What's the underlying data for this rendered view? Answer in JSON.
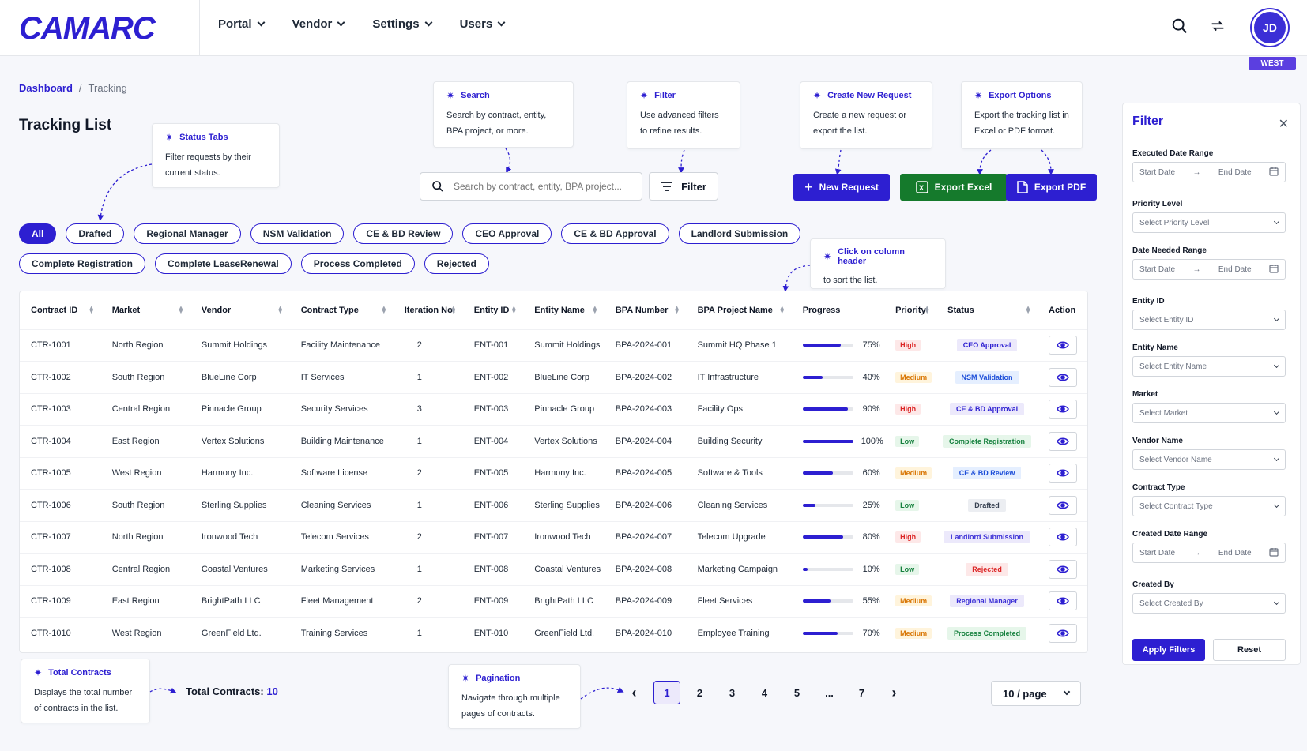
{
  "brand": {
    "logo": "CAMARC"
  },
  "nav": [
    "Portal",
    "Vendor",
    "Settings",
    "Users"
  ],
  "user": {
    "initials": "JD",
    "region": "WEST"
  },
  "breadcrumb": {
    "home": "Dashboard",
    "sep": "/",
    "current": "Tracking"
  },
  "page_title": "Tracking List",
  "callouts": {
    "status_tabs": {
      "title": "Status Tabs",
      "desc": "Filter requests by their current status."
    },
    "search": {
      "title": "Search",
      "desc": "Search by contract, entity, BPA project, or more."
    },
    "filter": {
      "title": "Filter",
      "desc": "Use advanced filters to refine results."
    },
    "create": {
      "title": "Create New Request",
      "desc": "Create a new request or export the list."
    },
    "export": {
      "title": "Export Options",
      "desc": "Export the tracking list in Excel or PDF format."
    },
    "sort": {
      "title": "Click on column header",
      "desc": "to sort the list."
    },
    "total": {
      "title": "Total Contracts",
      "desc": "Displays the total number of contracts in the list."
    },
    "pagination": {
      "title": "Pagination",
      "desc": "Navigate through multiple pages of contracts."
    }
  },
  "search": {
    "placeholder": "Search by contract, entity, BPA project..."
  },
  "toolbar": {
    "filter_label": "Filter",
    "new_label": "New Request",
    "excel_label": "Export Excel",
    "pdf_label": "Export PDF"
  },
  "tabs_row1": [
    "All",
    "Drafted",
    "Regional Manager",
    "NSM Validation",
    "CE & BD Review",
    "CEO Approval",
    "CE & BD Approval",
    "Landlord Submission"
  ],
  "tabs_row2": [
    "Complete Registration",
    "Complete LeaseRenewal",
    "Process Completed",
    "Rejected"
  ],
  "active_tab": "All",
  "table": {
    "columns": [
      "Contract ID",
      "Market",
      "Vendor",
      "Contract Type",
      "Iteration No.",
      "Entity ID",
      "Entity Name",
      "BPA Number",
      "BPA Project Name",
      "Progress",
      "Priority",
      "Status",
      "Action"
    ],
    "rows": [
      {
        "id": "CTR-1001",
        "market": "North Region",
        "vendor": "Summit Holdings",
        "type": "Facility Maintenance",
        "iter": "2",
        "entity_id": "ENT-001",
        "entity_name": "Summit Holdings",
        "bpa": "BPA-2024-001",
        "project": "Summit HQ Phase 1",
        "progress": 75,
        "progress_label": "75%",
        "priority": "High",
        "status": "CEO Approval"
      },
      {
        "id": "CTR-1002",
        "market": "South Region",
        "vendor": "BlueLine Corp",
        "type": "IT Services",
        "iter": "1",
        "entity_id": "ENT-002",
        "entity_name": "BlueLine Corp",
        "bpa": "BPA-2024-002",
        "project": "IT Infrastructure",
        "progress": 40,
        "progress_label": "40%",
        "priority": "Medium",
        "status": "NSM Validation"
      },
      {
        "id": "CTR-1003",
        "market": "Central Region",
        "vendor": "Pinnacle Group",
        "type": "Security Services",
        "iter": "3",
        "entity_id": "ENT-003",
        "entity_name": "Pinnacle Group",
        "bpa": "BPA-2024-003",
        "project": "Facility Ops",
        "progress": 90,
        "progress_label": "90%",
        "priority": "High",
        "status": "CE & BD Approval"
      },
      {
        "id": "CTR-1004",
        "market": "East Region",
        "vendor": "Vertex Solutions",
        "type": "Building Maintenance",
        "iter": "1",
        "entity_id": "ENT-004",
        "entity_name": "Vertex Solutions",
        "bpa": "BPA-2024-004",
        "project": "Building Security",
        "progress": 100,
        "progress_label": "100%",
        "priority": "Low",
        "status": "Complete Registration"
      },
      {
        "id": "CTR-1005",
        "market": "West Region",
        "vendor": "Harmony Inc.",
        "type": "Software License",
        "iter": "2",
        "entity_id": "ENT-005",
        "entity_name": "Harmony Inc.",
        "bpa": "BPA-2024-005",
        "project": "Software & Tools",
        "progress": 60,
        "progress_label": "60%",
        "priority": "Medium",
        "status": "CE & BD Review"
      },
      {
        "id": "CTR-1006",
        "market": "South Region",
        "vendor": "Sterling Supplies",
        "type": "Cleaning Services",
        "iter": "1",
        "entity_id": "ENT-006",
        "entity_name": "Sterling Supplies",
        "bpa": "BPA-2024-006",
        "project": "Cleaning Services",
        "progress": 25,
        "progress_label": "25%",
        "priority": "Low",
        "status": "Drafted"
      },
      {
        "id": "CTR-1007",
        "market": "North Region",
        "vendor": "Ironwood Tech",
        "type": "Telecom Services",
        "iter": "2",
        "entity_id": "ENT-007",
        "entity_name": "Ironwood Tech",
        "bpa": "BPA-2024-007",
        "project": "Telecom Upgrade",
        "progress": 80,
        "progress_label": "80%",
        "priority": "High",
        "status": "Landlord Submission"
      },
      {
        "id": "CTR-1008",
        "market": "Central Region",
        "vendor": "Coastal Ventures",
        "type": "Marketing Services",
        "iter": "1",
        "entity_id": "ENT-008",
        "entity_name": "Coastal Ventures",
        "bpa": "BPA-2024-008",
        "project": "Marketing Campaign",
        "progress": 10,
        "progress_label": "10%",
        "priority": "Low",
        "status": "Rejected"
      },
      {
        "id": "CTR-1009",
        "market": "East Region",
        "vendor": "BrightPath LLC",
        "type": "Fleet Management",
        "iter": "2",
        "entity_id": "ENT-009",
        "entity_name": "BrightPath LLC",
        "bpa": "BPA-2024-009",
        "project": "Fleet Services",
        "progress": 55,
        "progress_label": "55%",
        "priority": "Medium",
        "status": "Regional Manager"
      },
      {
        "id": "CTR-1010",
        "market": "West Region",
        "vendor": "GreenField Ltd.",
        "type": "Training Services",
        "iter": "1",
        "entity_id": "ENT-010",
        "entity_name": "GreenField Ltd.",
        "bpa": "BPA-2024-010",
        "project": "Employee Training",
        "progress": 70,
        "progress_label": "70%",
        "priority": "Medium",
        "status": "Process Completed"
      }
    ]
  },
  "status_colors": {
    "CEO Approval": {
      "bg": "#ece9fb",
      "fg": "#2d1fd1"
    },
    "NSM Validation": {
      "bg": "#e5efff",
      "fg": "#1d4ed8"
    },
    "CE & BD Approval": {
      "bg": "#ece9fb",
      "fg": "#2d1fd1"
    },
    "Complete Registration": {
      "bg": "#e6f6ea",
      "fg": "#15803d"
    },
    "CE & BD Review": {
      "bg": "#e5efff",
      "fg": "#1d4ed8"
    },
    "Drafted": {
      "bg": "#eceef2",
      "fg": "#374151"
    },
    "Landlord Submission": {
      "bg": "#ece9fb",
      "fg": "#3b2fd6"
    },
    "Rejected": {
      "bg": "#fde8e8",
      "fg": "#dc2626"
    },
    "Regional Manager": {
      "bg": "#ece9fb",
      "fg": "#3b2fd6"
    },
    "Process Completed": {
      "bg": "#e6f6ea",
      "fg": "#15803d"
    }
  },
  "footer": {
    "total_label": "Total Contracts:",
    "total_value": "10",
    "pages": [
      "1",
      "2",
      "3",
      "4",
      "5",
      "...",
      "7"
    ],
    "current_page": "1",
    "page_size": "10 / page"
  },
  "filter_panel": {
    "title": "Filter",
    "fields": [
      {
        "label": "Executed Date Range",
        "kind": "range",
        "start": "Start Date",
        "end": "End Date"
      },
      {
        "label": "Priority Level",
        "kind": "select",
        "placeholder": "Select Priority Level"
      },
      {
        "label": "Date Needed Range",
        "kind": "range",
        "start": "Start Date",
        "end": "End Date"
      },
      {
        "label": "Entity ID",
        "kind": "select",
        "placeholder": "Select Entity ID"
      },
      {
        "label": "Entity Name",
        "kind": "select",
        "placeholder": "Select Entity Name"
      },
      {
        "label": "Market",
        "kind": "select",
        "placeholder": "Select Market"
      },
      {
        "label": "Vendor Name",
        "kind": "select",
        "placeholder": "Select Vendor Name"
      },
      {
        "label": "Contract Type",
        "kind": "select",
        "placeholder": "Select Contract Type"
      },
      {
        "label": "Created Date Range",
        "kind": "range",
        "start": "Start Date",
        "end": "End Date"
      },
      {
        "label": "Created By",
        "kind": "select",
        "placeholder": "Select Created By"
      }
    ],
    "apply_label": "Apply Filters",
    "reset_label": "Reset"
  },
  "colors": {
    "brand": "#2d1fd1",
    "excel": "#157a2c"
  }
}
